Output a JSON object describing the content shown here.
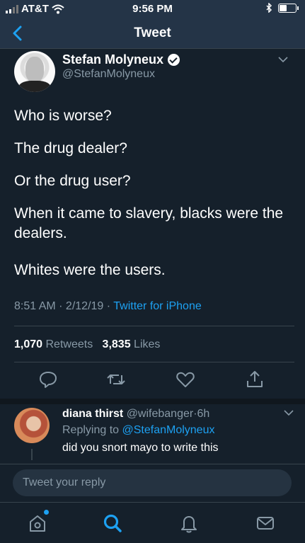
{
  "status": {
    "carrier": "AT&T",
    "time": "9:56 PM"
  },
  "nav": {
    "title": "Tweet"
  },
  "tweet": {
    "author_name": "Stefan Molyneux",
    "author_handle": "@StefanMolyneux",
    "lines": [
      "Who is worse?",
      "The drug dealer?",
      "Or the drug user?",
      "When it came to slavery, blacks were the dealers.",
      "Whites were the users."
    ],
    "time": "8:51 AM",
    "date": "2/12/19",
    "source": "Twitter for iPhone",
    "retweets_count": "1,070",
    "retweets_label": "Retweets",
    "likes_count": "3,835",
    "likes_label": "Likes"
  },
  "reply": {
    "name": "diana thirst",
    "handle": "@wifebanger",
    "age": "6h",
    "replying_prefix": "Replying to",
    "replying_handle": "@StefanMolyneux",
    "text": "did you snort mayo to write this"
  },
  "compose": {
    "placeholder": "Tweet your reply"
  },
  "colors": {
    "background": "#15202b",
    "header": "#243447",
    "accent": "#1da1f2",
    "muted": "#8899a6"
  },
  "icons": [
    "back-icon",
    "verified-icon",
    "chevron-down-icon",
    "reply-icon",
    "retweet-icon",
    "like-icon",
    "share-icon",
    "home-icon",
    "search-icon",
    "notifications-icon",
    "messages-icon"
  ]
}
